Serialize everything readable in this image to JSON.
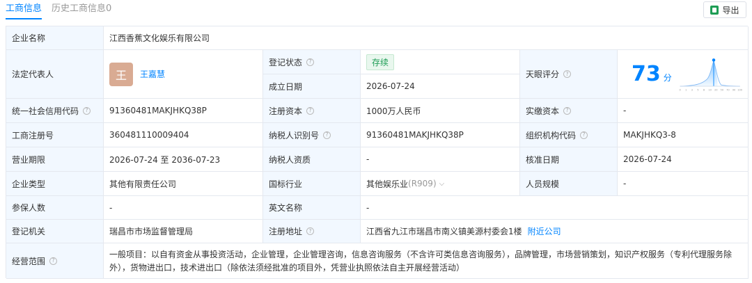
{
  "tabs": {
    "active": "工商信息",
    "inactive": "历史工商信息0"
  },
  "export_label": "导出",
  "company_name": {
    "label": "企业名称",
    "value": "江西香蕉文化娱乐有限公司"
  },
  "legal_rep": {
    "label": "法定代表人",
    "avatar_char": "王",
    "name": "王嘉慧"
  },
  "reg_status": {
    "label": "登记状态",
    "value": "存续"
  },
  "est_date": {
    "label": "成立日期",
    "value": "2026-07-24"
  },
  "tianyan": {
    "label": "天眼评分",
    "score": "73",
    "unit": "分",
    "ticks": [
      "0",
      "1",
      "3",
      "5",
      "8",
      "10",
      "20",
      "50",
      "70",
      "90",
      "100"
    ]
  },
  "credit_code": {
    "label": "统一社会信用代码",
    "value": "91360481MAKJHKQ38P"
  },
  "reg_capital": {
    "label": "注册资本",
    "value": "1000万人民币"
  },
  "paid_capital": {
    "label": "实缴资本",
    "value": "-"
  },
  "reg_no": {
    "label": "工商注册号",
    "value": "360481110009404"
  },
  "taxpayer_id": {
    "label": "纳税人识别号",
    "value": "91360481MAKJHKQ38P"
  },
  "org_code": {
    "label": "组织机构代码",
    "value": "MAKJHKQ3-8"
  },
  "term": {
    "label": "营业期限",
    "value": "2026-07-24 至 2036-07-23"
  },
  "taxpayer_qual": {
    "label": "纳税人资质",
    "value": "-"
  },
  "approval_date": {
    "label": "核准日期",
    "value": "2026-07-24"
  },
  "company_type": {
    "label": "企业类型",
    "value": "其他有限责任公司"
  },
  "industry": {
    "label": "国标行业",
    "value": "其他娱乐业",
    "code": "(R909)"
  },
  "staff_size": {
    "label": "人员规模",
    "value": "-"
  },
  "insured": {
    "label": "参保人数",
    "value": "-"
  },
  "english_name": {
    "label": "英文名称",
    "value": "-"
  },
  "authority": {
    "label": "登记机关",
    "value": "瑞昌市市场监督管理局"
  },
  "address": {
    "label": "注册地址",
    "value": "江西省九江市瑞昌市南义镇美源村委会1楼",
    "nearby": "附近公司"
  },
  "scope": {
    "label": "经营范围",
    "value": "一般项目：以自有资金从事投资活动，企业管理，企业管理咨询，信息咨询服务（不含许可类信息咨询服务），品牌管理，市场营销策划，知识产权服务（专利代理服务除外），货物进出口，技术进出口（除依法须经批准的项目外，凭营业执照依法自主开展经营活动）"
  },
  "colors": {
    "accent": "#0084ff",
    "label_bg": "#f2f8ff",
    "status_green": "#1e9d55",
    "avatar_bg": "#d9ab93"
  }
}
